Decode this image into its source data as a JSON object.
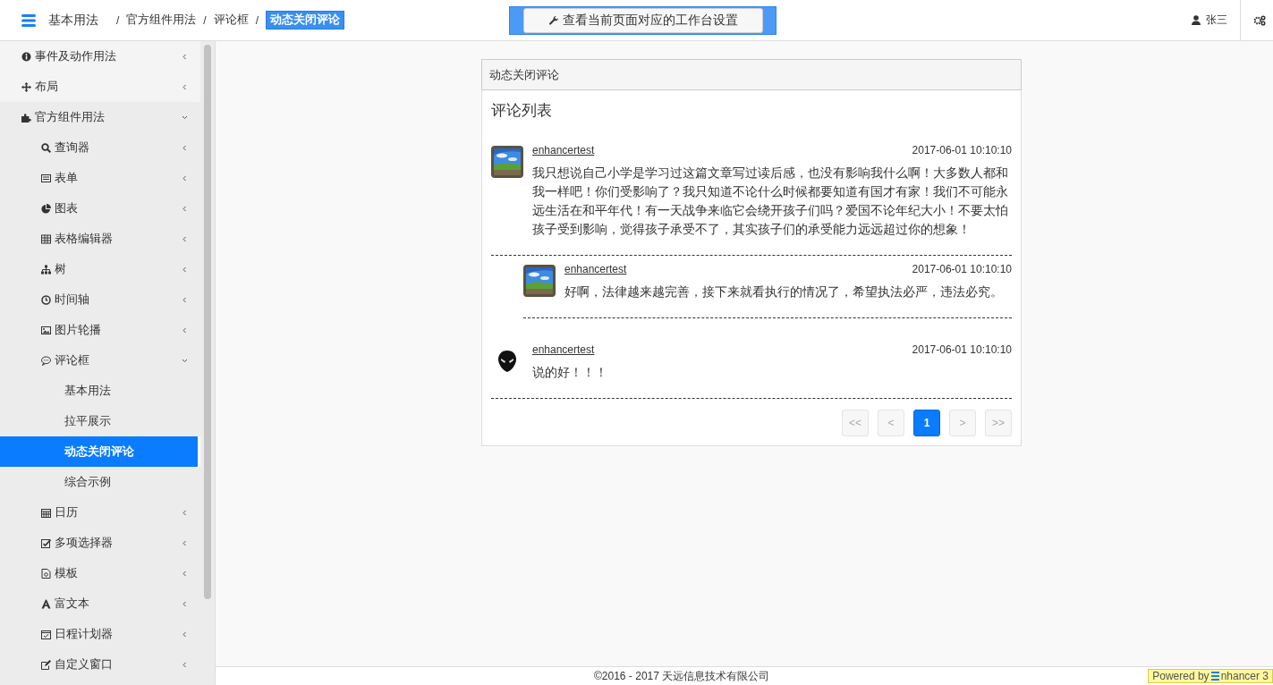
{
  "header": {
    "app_title": "基本用法",
    "breadcrumbs": [
      {
        "separator": "/",
        "label": "官方组件用法",
        "selected": false
      },
      {
        "separator": "/",
        "label": "评论框",
        "selected": false
      },
      {
        "separator": "/",
        "label": "动态关闭评论",
        "selected": true
      }
    ],
    "workbench_button": "查看当前页面对应的工作台设置",
    "user": "张三"
  },
  "sidebar": {
    "items": [
      {
        "label": "事件及动作用法",
        "expanded": false,
        "selected": false
      },
      {
        "label": "布局",
        "expanded": false,
        "selected": false
      },
      {
        "label": "官方组件用法",
        "expanded": true,
        "selected": false,
        "children": [
          {
            "label": "查询器",
            "expanded": false,
            "selected": false
          },
          {
            "label": "表单",
            "expanded": false,
            "selected": false
          },
          {
            "label": "图表",
            "expanded": false,
            "selected": false
          },
          {
            "label": "表格编辑器",
            "expanded": false,
            "selected": false
          },
          {
            "label": "树",
            "expanded": false,
            "selected": false
          },
          {
            "label": "时间轴",
            "expanded": false,
            "selected": false
          },
          {
            "label": "图片轮播",
            "expanded": false,
            "selected": false
          },
          {
            "label": "评论框",
            "expanded": true,
            "selected": false,
            "children": [
              {
                "label": "基本用法",
                "selected": false
              },
              {
                "label": "拉平展示",
                "selected": false
              },
              {
                "label": "动态关闭评论",
                "selected": true
              },
              {
                "label": "综合示例",
                "selected": false
              }
            ]
          },
          {
            "label": "日历",
            "expanded": false,
            "selected": false
          },
          {
            "label": "多项选择器",
            "expanded": false,
            "selected": false
          },
          {
            "label": "模板",
            "expanded": false,
            "selected": false
          },
          {
            "label": "富文本",
            "expanded": false,
            "selected": false
          },
          {
            "label": "日程计划器",
            "expanded": false,
            "selected": false
          },
          {
            "label": "自定义窗口",
            "expanded": false,
            "selected": false
          }
        ]
      }
    ]
  },
  "panel": {
    "title": "动态关闭评论",
    "heading": "评论列表",
    "comments": [
      {
        "author": "enhancertest",
        "time": "2017-06-01 10:10:10",
        "avatar": {
          "kind": "picture"
        },
        "text": "我只想说自己小学是学习过这篇文章写过读后感，也没有影响我什么啊！大多数人都和我一样吧！你们受影响了？我只知道不论什么时候都要知道有国才有家！我们不可能永远生活在和平年代！有一天战争来临它会绕开孩子们吗？爱国不论年纪大小！不要太怕孩子受到影响，觉得孩子承受不了，其实孩子们的承受能力远远超过你的想象！",
        "replies": [
          {
            "author": "enhancertest",
            "time": "2017-06-01 10:10:10",
            "avatar": {
              "kind": "picture"
            },
            "text": "好啊，法律越来越完善，接下来就看执行的情况了，希望执法必严，违法必究。"
          }
        ]
      },
      {
        "author": "enhancertest",
        "time": "2017-06-01 10:10:10",
        "avatar": {
          "kind": "alien"
        },
        "text": "说的好！！！"
      }
    ],
    "pagination": [
      {
        "label": "<<",
        "disabled": true,
        "selected": false
      },
      {
        "label": "<",
        "disabled": true,
        "selected": false
      },
      {
        "label": "1",
        "disabled": false,
        "selected": true
      },
      {
        "label": ">",
        "disabled": true,
        "selected": false
      },
      {
        "label": ">>",
        "disabled": true,
        "selected": false
      }
    ]
  },
  "footer": {
    "copyright": "©2016 - 2017 天远信息技术有限公司",
    "powered_by": "Powered by",
    "brand": "nhancer 3"
  }
}
